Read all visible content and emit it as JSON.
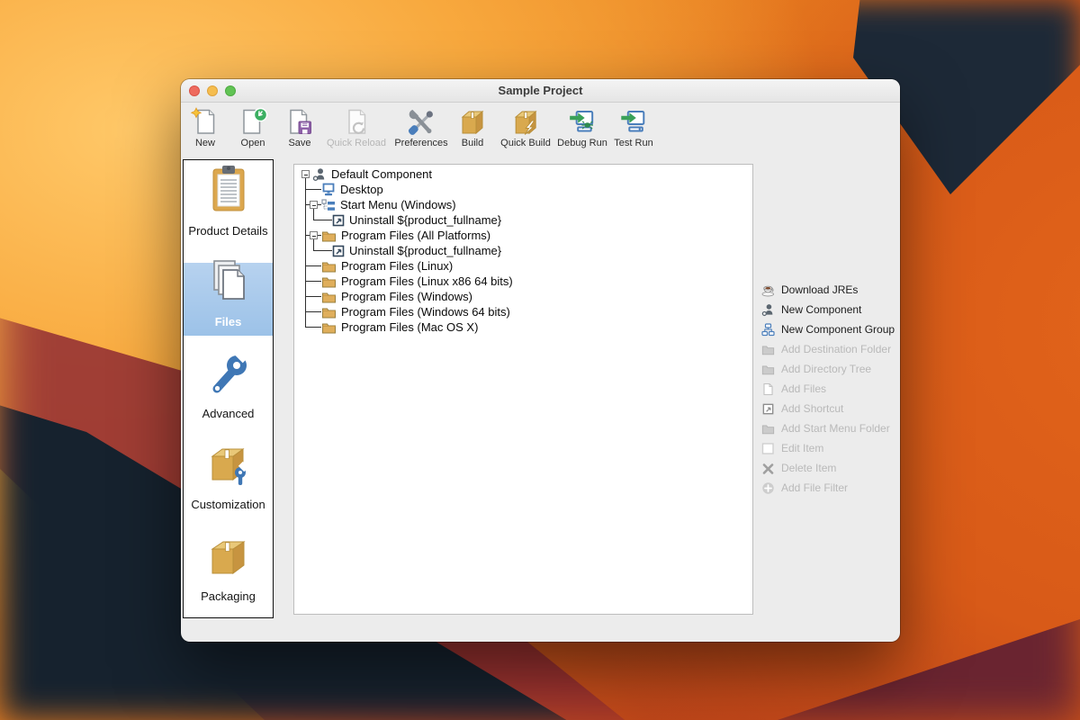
{
  "window": {
    "title": "Sample Project"
  },
  "toolbar": {
    "items": [
      {
        "label": "New",
        "icon": "new-document-icon",
        "enabled": true
      },
      {
        "label": "Open",
        "icon": "open-document-icon",
        "enabled": true
      },
      {
        "label": "Save",
        "icon": "save-document-icon",
        "enabled": true
      },
      {
        "label": "Quick Reload",
        "icon": "reload-document-icon",
        "enabled": false
      },
      {
        "label": "Preferences",
        "icon": "tools-icon",
        "enabled": true
      },
      {
        "label": "Build",
        "icon": "package-box-icon",
        "enabled": true
      },
      {
        "label": "Quick Build",
        "icon": "package-bolt-icon",
        "enabled": true
      },
      {
        "label": "Debug Run",
        "icon": "monitor-bug-icon",
        "enabled": true
      },
      {
        "label": "Test Run",
        "icon": "monitor-run-icon",
        "enabled": true
      }
    ]
  },
  "sidebar": {
    "items": [
      {
        "label": "Product Details",
        "icon": "clipboard-icon",
        "selected": false
      },
      {
        "label": "Files",
        "icon": "files-stack-icon",
        "selected": true
      },
      {
        "label": "Advanced",
        "icon": "wrench-icon",
        "selected": false
      },
      {
        "label": "Customization",
        "icon": "box-wrench-icon",
        "selected": false
      },
      {
        "label": "Packaging",
        "icon": "box-icon",
        "selected": false
      }
    ]
  },
  "tree": {
    "items": [
      {
        "label": "Default Component",
        "level": 0,
        "icon": "component-icon",
        "expanded": true
      },
      {
        "label": "Desktop",
        "level": 1,
        "icon": "desktop-icon"
      },
      {
        "label": "Start Menu (Windows)",
        "level": 1,
        "icon": "start-menu-icon",
        "expanded": true
      },
      {
        "label": "Uninstall ${product_fullname}",
        "level": 2,
        "icon": "shortcut-icon"
      },
      {
        "label": "Program Files (All Platforms)",
        "level": 1,
        "icon": "folder-icon",
        "expanded": true
      },
      {
        "label": "Uninstall ${product_fullname}",
        "level": 2,
        "icon": "shortcut-icon"
      },
      {
        "label": "Program Files (Linux)",
        "level": 1,
        "icon": "folder-icon"
      },
      {
        "label": "Program Files (Linux x86 64 bits)",
        "level": 1,
        "icon": "folder-icon"
      },
      {
        "label": "Program Files (Windows)",
        "level": 1,
        "icon": "folder-icon"
      },
      {
        "label": "Program Files (Windows 64 bits)",
        "level": 1,
        "icon": "folder-icon"
      },
      {
        "label": "Program Files (Mac OS X)",
        "level": 1,
        "icon": "folder-icon"
      }
    ]
  },
  "actions": {
    "items": [
      {
        "label": "Download JREs",
        "icon": "coffee-cup-icon",
        "enabled": true
      },
      {
        "label": "New Component",
        "icon": "component-icon",
        "enabled": true
      },
      {
        "label": "New Component Group",
        "icon": "component-group-icon",
        "enabled": true
      },
      {
        "label": "Add Destination Folder",
        "icon": "folder-gray-icon",
        "enabled": false
      },
      {
        "label": "Add Directory Tree",
        "icon": "folder-gray-icon",
        "enabled": false
      },
      {
        "label": "Add Files",
        "icon": "document-gray-icon",
        "enabled": false
      },
      {
        "label": "Add Shortcut",
        "icon": "shortcut-gray-icon",
        "enabled": false
      },
      {
        "label": "Add Start Menu Folder",
        "icon": "folder-gray-icon",
        "enabled": false
      },
      {
        "label": "Edit Item",
        "icon": "square-outline-icon",
        "enabled": false
      },
      {
        "label": "Delete Item",
        "icon": "x-mark-icon",
        "enabled": false
      },
      {
        "label": "Add File Filter",
        "icon": "plus-circle-icon",
        "enabled": false
      }
    ]
  },
  "colors": {
    "accent_gold": "#d9a94e",
    "accent_blue": "#4a7ebb",
    "selection_blue": "#a9c9ec",
    "enabled_text": "#1c1c1c",
    "disabled_text": "#b9b9b9",
    "window_bg": "#ececec"
  }
}
